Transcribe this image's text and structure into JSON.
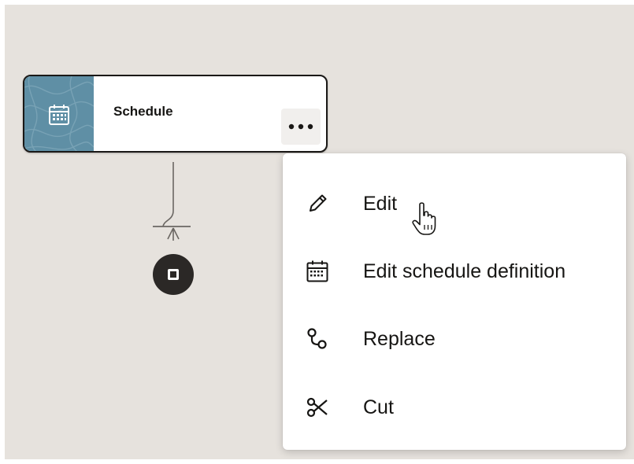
{
  "node": {
    "title": "Schedule",
    "icon": "calendar-icon",
    "more_icon": "more-icon",
    "accent_color": "#5f8fa5"
  },
  "end_node": {
    "icon": "stop-icon"
  },
  "menu": {
    "items": [
      {
        "label": "Edit",
        "icon": "pencil-icon"
      },
      {
        "label": "Edit schedule definition",
        "icon": "calendar-grid-icon"
      },
      {
        "label": "Replace",
        "icon": "replace-icon"
      },
      {
        "label": "Cut",
        "icon": "scissors-icon"
      }
    ]
  },
  "colors": {
    "canvas_bg": "#e6e2dd",
    "text": "#161513",
    "end_node_bg": "#2b2826"
  }
}
